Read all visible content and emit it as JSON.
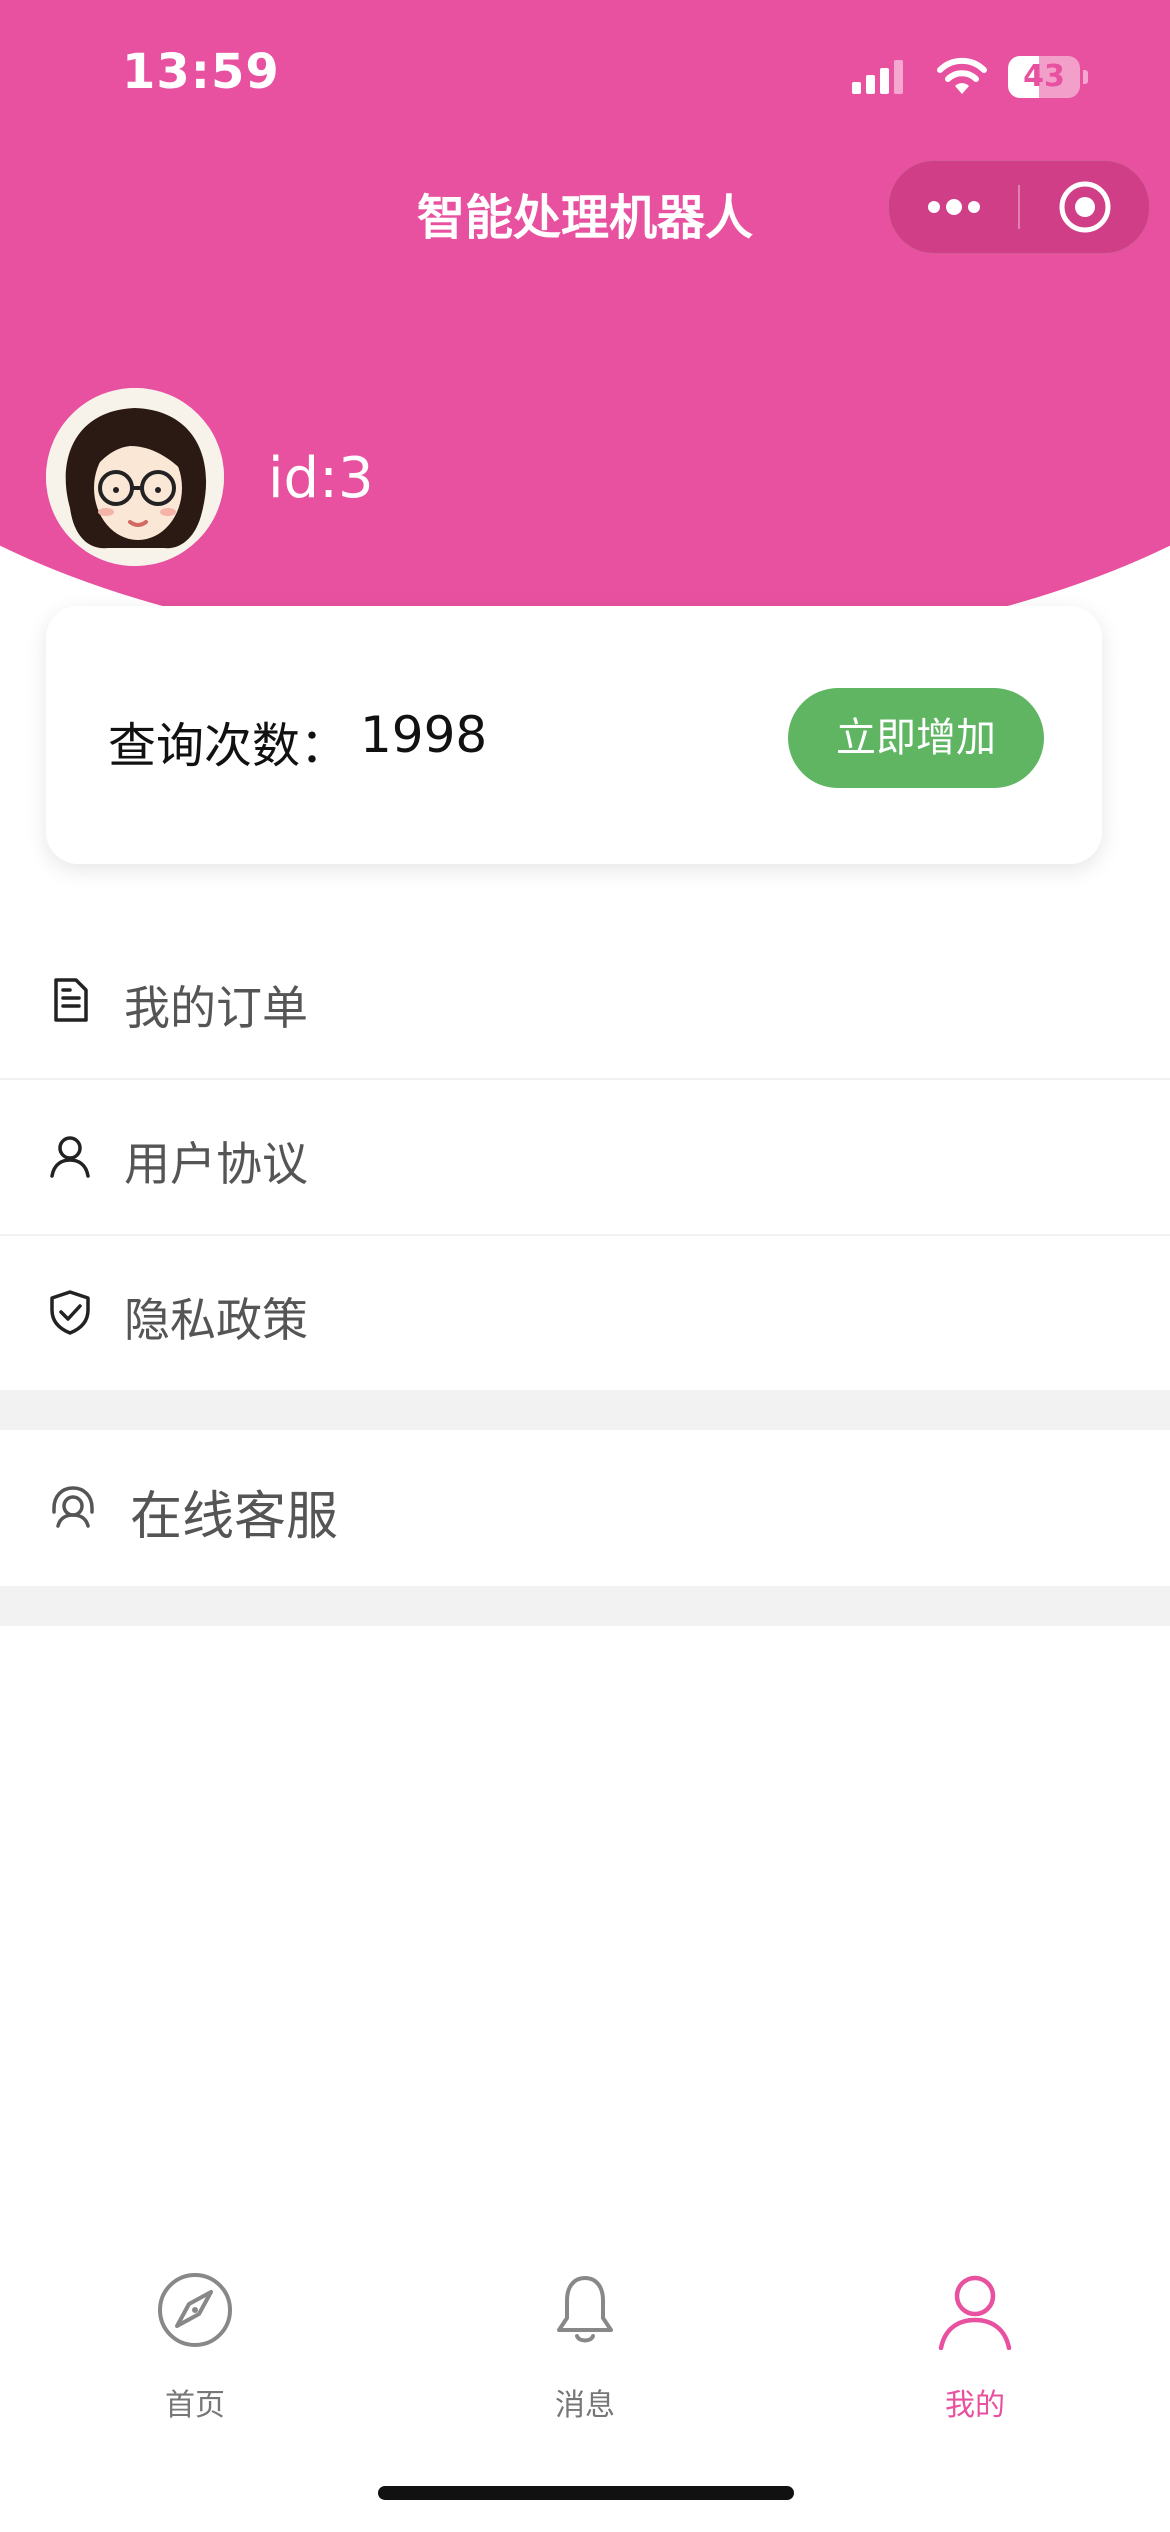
{
  "status_bar": {
    "time": "13:59",
    "battery_level": "43",
    "battery_fraction": 0.43
  },
  "nav": {
    "title": "智能处理机器人",
    "more_icon": "more-dots-icon",
    "close_icon": "target-close-icon"
  },
  "profile": {
    "user_id": "id:3",
    "avatar_icon": "avatar-girl-with-glasses"
  },
  "count_card": {
    "label": "查询次数：",
    "value": "1998",
    "add_button_label": "立即增加"
  },
  "menu": {
    "items": [
      {
        "label": "我的订单",
        "icon": "document-icon"
      },
      {
        "label": "用户协议",
        "icon": "user-icon"
      },
      {
        "label": "隐私政策",
        "icon": "shield-check-icon"
      }
    ],
    "service": {
      "label": "在线客服",
      "icon": "headset-icon"
    }
  },
  "tab_bar": {
    "tabs": [
      {
        "label": "首页",
        "icon": "compass-icon",
        "active": false
      },
      {
        "label": "消息",
        "icon": "bell-icon",
        "active": false
      },
      {
        "label": "我的",
        "icon": "person-icon",
        "active": true
      }
    ]
  },
  "colors": {
    "brand_pink": "#e8519f",
    "button_green": "#5fb562",
    "text_gray": "#555555",
    "background": "#ffffff"
  }
}
